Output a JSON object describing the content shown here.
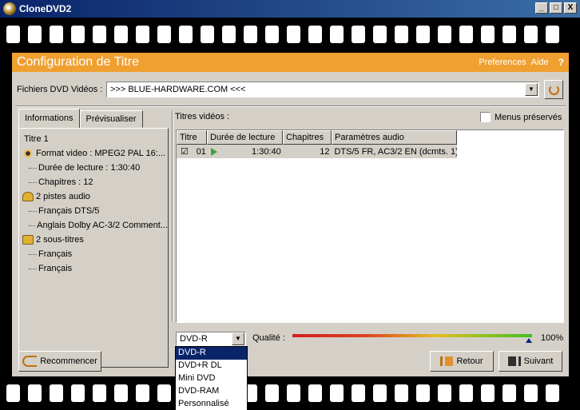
{
  "window": {
    "title": "CloneDVD2",
    "btn_min": "_",
    "btn_max": "□",
    "btn_close": "X"
  },
  "header": {
    "title": "Configuration de Titre",
    "preferences": "Preferences",
    "aide": "Aide",
    "help": "?"
  },
  "source": {
    "label": "Fichiers DVD Vidéos :",
    "value": ">>> BLUE-HARDWARE.COM <<<",
    "dropdown": "▼"
  },
  "tabs": [
    {
      "label": "Informations"
    },
    {
      "label": "Prévisualiser"
    }
  ],
  "tree": {
    "title": "Titre 1",
    "format": "Format video : MPEG2 PAL 16:...",
    "duree": "Durée de lecture : 1:30:40",
    "chapitres": "Chapitres : 12",
    "audio_group": "2 pistes audio",
    "audio": [
      "Français DTS/5",
      "Anglais Dolby AC-3/2 Comment..."
    ],
    "subs_group": "2 sous-titres",
    "subs": [
      "Français",
      "Français"
    ]
  },
  "titres": {
    "label": "Titres vidéos :",
    "menus_label": "Menus préservés",
    "columns": [
      "Titre",
      "Durée de lecture",
      "Chapitres",
      "Paramètres audio"
    ],
    "rows": [
      {
        "check": "☑",
        "titre": "01",
        "duree": "1:30:40",
        "chapitres": "12",
        "audio": "DTS/5 FR, AC3/2 EN (dcmts. 1)"
      }
    ]
  },
  "output": {
    "selected": "DVD-R",
    "dropdown": "▼",
    "options": [
      "DVD-R",
      "DVD+R DL",
      "Mini DVD",
      "DVD-RAM",
      "Personnalisé"
    ],
    "qualite_label": "Qualité :",
    "qualite_value": "100%",
    "qualite_level": 1.0
  },
  "buttons": {
    "recommencer": "Recommencer",
    "retour": "Retour",
    "suivant": "Suivant"
  }
}
